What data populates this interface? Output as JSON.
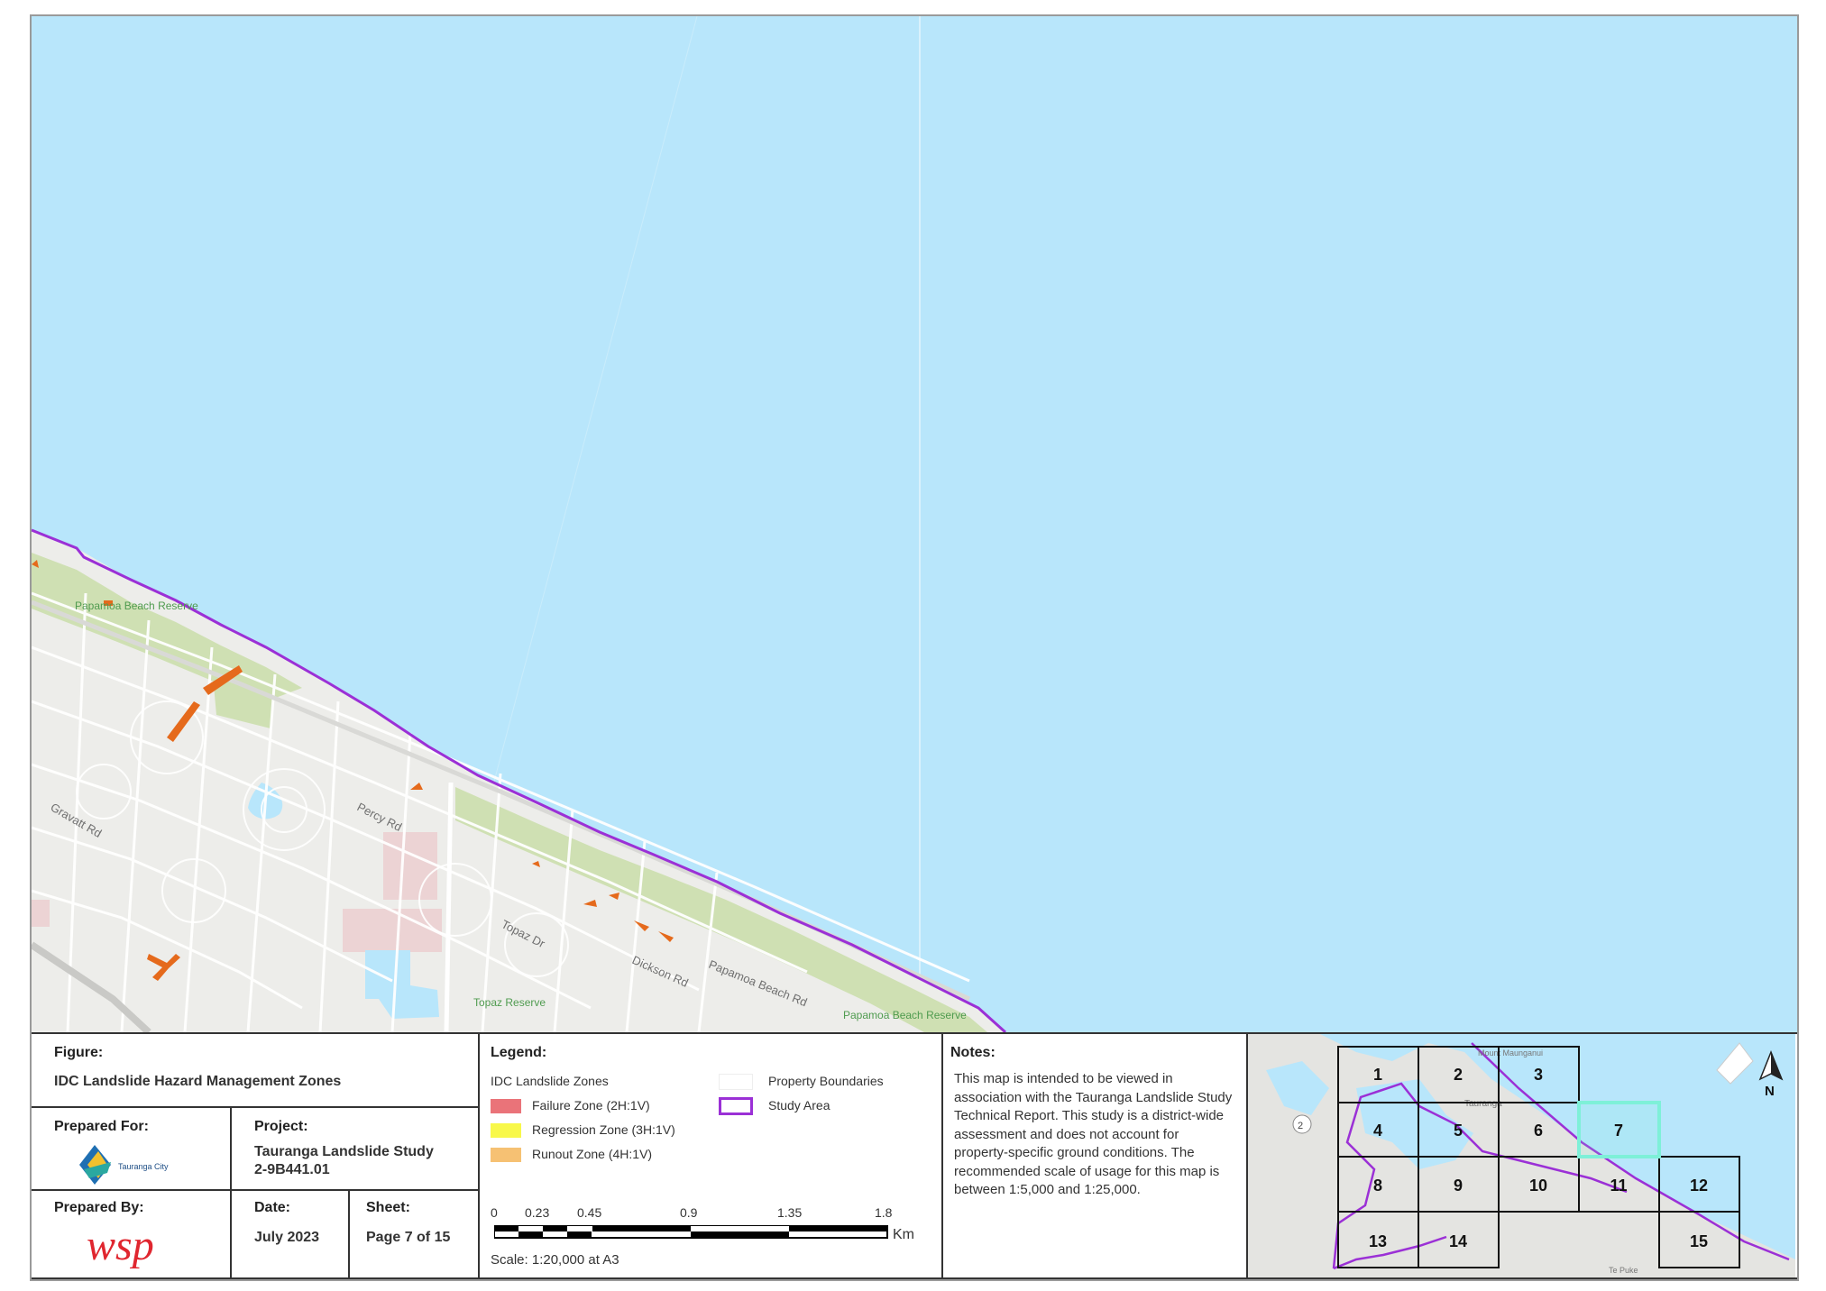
{
  "map": {
    "street_labels": [
      "Gravatt Rd",
      "Percy Rd",
      "Topaz Dr",
      "Dickson Rd",
      "Papamoa Beach Rd"
    ],
    "reserve_labels": [
      "Papamoa Beach Reserve",
      "Topaz Reserve",
      "Papamoa Beach Reserve"
    ],
    "colors": {
      "sea": "#b8e6fb",
      "land": "#ededea",
      "reserve": "#cfe0b3",
      "study_area": "#9b30d6",
      "hazard": "#e56a1c"
    }
  },
  "figure": {
    "label": "Figure:",
    "title": "IDC Landslide Hazard Management Zones"
  },
  "prepared_for": {
    "label": "Prepared For:",
    "logo_text": "Tauranga City"
  },
  "project": {
    "label": "Project:",
    "name": "Tauranga Landslide Study",
    "number": "2-9B441.01"
  },
  "prepared_by": {
    "label": "Prepared By:",
    "logo_text": "wsp"
  },
  "date": {
    "label": "Date:",
    "value": "July 2023"
  },
  "sheet": {
    "label": "Sheet:",
    "value": "Page 7 of 15"
  },
  "legend": {
    "label": "Legend:",
    "group_title": "IDC Landslide Zones",
    "items": [
      {
        "label": "Failure Zone (2H:1V)",
        "color": "#ea7379"
      },
      {
        "label": "Regression Zone (3H:1V)",
        "color": "#f8f84a"
      },
      {
        "label": "Runout Zone (4H:1V)",
        "color": "#f6c173"
      }
    ],
    "extra": [
      {
        "label": "Property Boundaries"
      },
      {
        "label": "Study Area",
        "color": "#9b30d6"
      }
    ],
    "scalebar": {
      "ticks": [
        "0",
        "0.23",
        "0.45",
        "0.9",
        "1.35",
        "1.8"
      ],
      "unit": "Km",
      "scale_text": "Scale: 1:20,000 at A3"
    }
  },
  "notes": {
    "label": "Notes:",
    "text": "This map is intended to be viewed in association with the Tauranga Landslide Study Technical Report. This study is a district-wide assessment and does not account for property-specific ground conditions. The recommended scale of usage for this map is between 1:5,000 and 1:25,000."
  },
  "inset": {
    "tiles": [
      "1",
      "2",
      "3",
      "4",
      "5",
      "6",
      "7",
      "8",
      "9",
      "10",
      "11",
      "12",
      "13",
      "14",
      "15"
    ],
    "highlight": "7",
    "north": "N",
    "route": "2",
    "place_labels": [
      "Mount Maunganui",
      "Tauranga",
      "Te Puke"
    ]
  }
}
